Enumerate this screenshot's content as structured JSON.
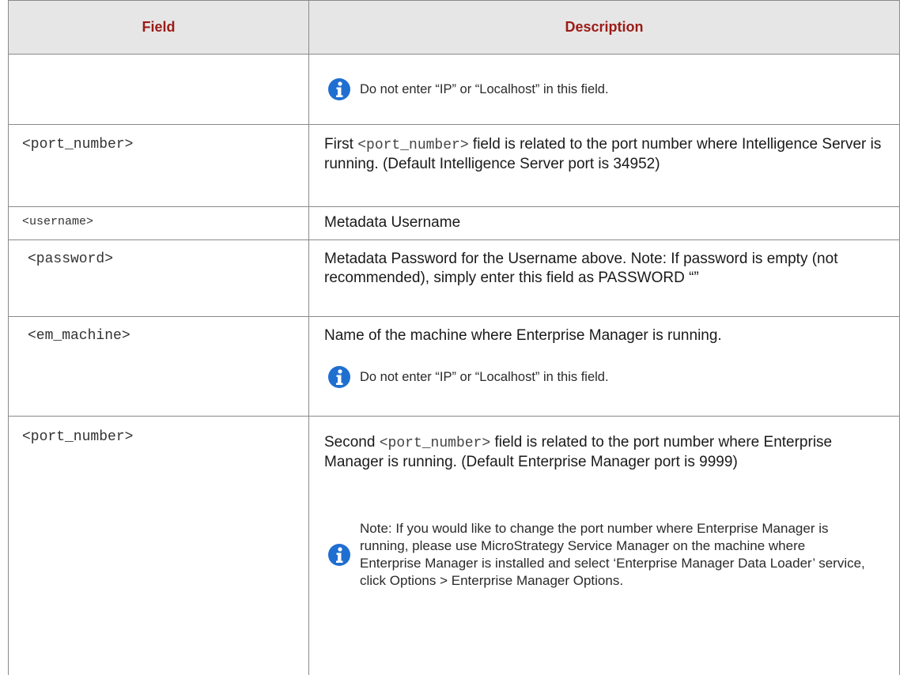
{
  "header": {
    "field": "Field",
    "description": "Description"
  },
  "rows": [
    {
      "field": "",
      "note": "Do not enter “IP” or “Localhost” in this field."
    },
    {
      "field": "<port_number>",
      "desc_pre": "First ",
      "desc_code": "<port_number>",
      "desc_post": " field is related to the port number where Intelligence Server is running. (Default Intelligence Server port is 34952)"
    },
    {
      "field": "<username>",
      "desc": "Metadata Username"
    },
    {
      "field": "<password>",
      "desc": "Metadata Password for the Username above. Note: If password is empty (not recommended), simply enter this field as PASSWORD “”"
    },
    {
      "field": "<em_machine>",
      "desc": "Name of the machine where Enterprise Manager is running.",
      "note": "Do not enter “IP” or “Localhost” in this field."
    },
    {
      "field": "<port_number>",
      "desc_pre": "Second ",
      "desc_code": "<port_number>",
      "desc_post": " field is related to the port number where Enterprise Manager is running. (Default Enterprise Manager port is 9999)",
      "note": "Note: If you would like to change the port number where Enterprise Manager is running, please use MicroStrategy Service Manager on the machine where Enterprise Manager is installed and select ‘Enterprise Manager Data Loader’ service, click Options > Enterprise Manager Options."
    }
  ],
  "icons": {
    "info": "info-icon",
    "info_color": "#1f6fd1"
  }
}
